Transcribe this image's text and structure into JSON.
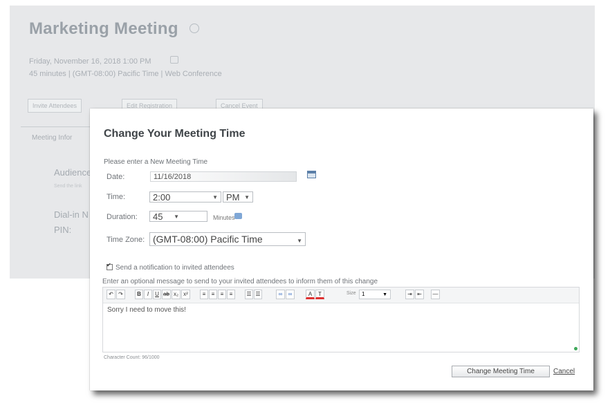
{
  "background": {
    "title": "Marketing Meeting",
    "date_line": "Friday, November 16, 2018 1:00 PM",
    "details_line": "45 minutes | (GMT-08:00) Pacific Time | Web Conference",
    "buttons": [
      "Invite Attendees",
      "Edit Registration",
      "Cancel Event"
    ],
    "tab_label": "Meeting Infor",
    "audience_label": "Audience",
    "audience_sub": "Send the link",
    "dialin_label": "Dial-in N",
    "pin_label": "PIN:"
  },
  "dialog": {
    "title": "Change Your Meeting Time",
    "prompt": "Please enter a New Meeting Time",
    "date_label": "Date:",
    "date_value": "11/16/2018",
    "time_label": "Time:",
    "time_value": "2:00",
    "ampm_value": "PM",
    "duration_label": "Duration:",
    "duration_value": "45",
    "minutes_label": "Minutes",
    "timezone_label": "Time Zone:",
    "timezone_value": "(GMT-08:00) Pacific Time",
    "notify_label": "Send a notification to invited attendees",
    "optional_message_label": "Enter an optional message to send to your invited attendees to inform them of this change",
    "editor_text": "Sorry I need to move this!",
    "size_label": "Size",
    "size_value": "1",
    "char_count": "Character Count: 96/1000",
    "submit_label": "Change Meeting Time",
    "cancel_label": "Cancel"
  },
  "toolbar_icons": [
    "undo-icon",
    "redo-icon",
    "bold-icon",
    "italic-icon",
    "underline-icon",
    "strikethrough-icon",
    "subscript-icon",
    "superscript-icon",
    "align-left-icon",
    "align-center-icon",
    "align-right-icon",
    "justify-icon",
    "ordered-list-icon",
    "unordered-list-icon",
    "link-icon",
    "unlink-icon",
    "font-color-icon",
    "clear-format-icon",
    "indent-icon",
    "outdent-icon",
    "horizontal-rule-icon"
  ],
  "colors": {
    "dialog_title": "#3f4448",
    "accent_red": "#e03030",
    "accent_blue": "#3b6fc4",
    "resize_dot": "#3fa85a"
  }
}
